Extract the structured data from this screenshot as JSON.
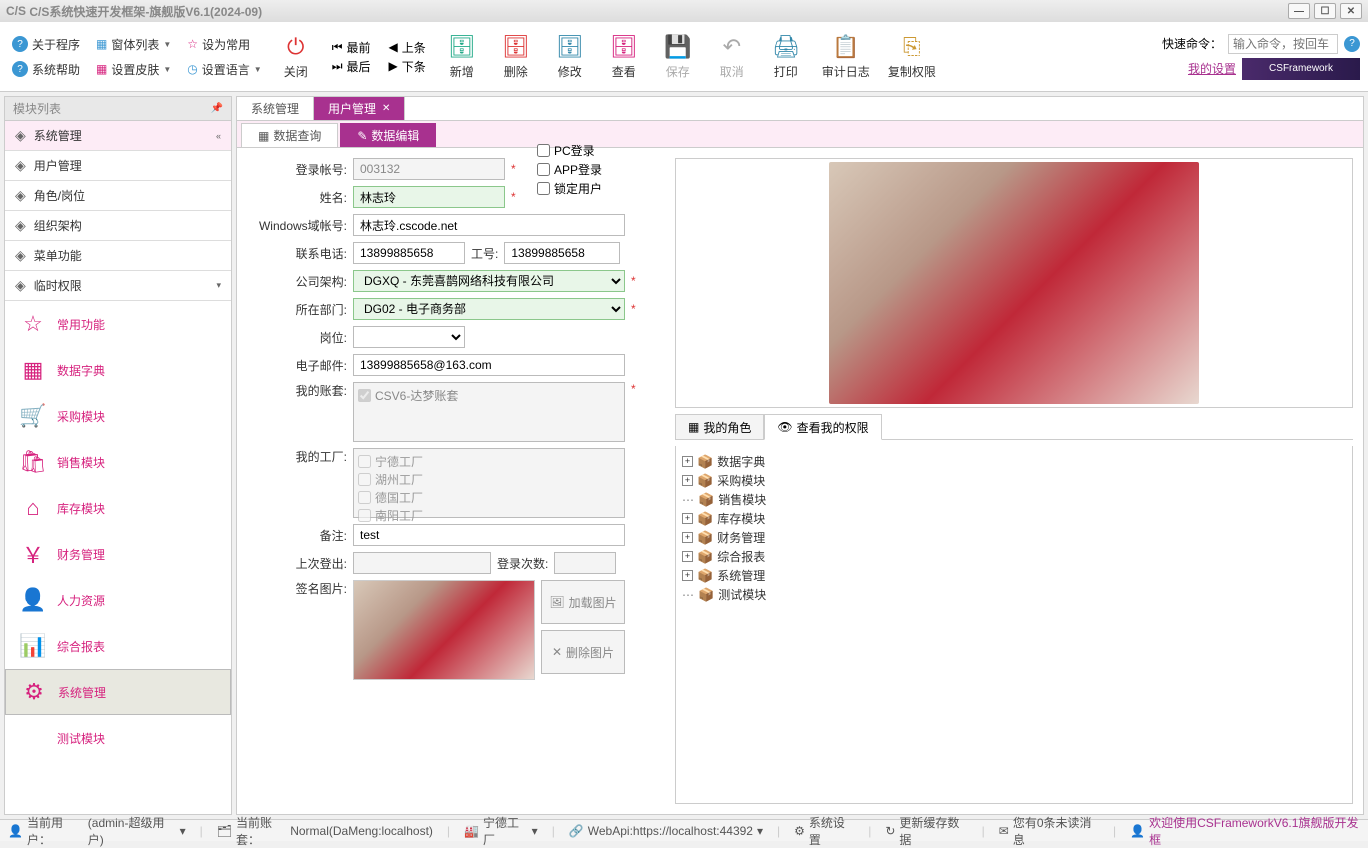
{
  "window_title": "C/S系统快速开发框架-旗舰版V6.1(2024-09)",
  "toolbar_links": {
    "about": "关于程序",
    "windows": "窗体列表",
    "set_common": "设为常用",
    "help": "系统帮助",
    "skin": "设置皮肤",
    "lang": "设置语言"
  },
  "nav": {
    "first": "最前",
    "prev": "上条",
    "last": "最后",
    "next": "下条"
  },
  "toolbar": {
    "close": "关闭",
    "add": "新增",
    "delete": "删除",
    "edit": "修改",
    "view": "查看",
    "save": "保存",
    "cancel": "取消",
    "print": "打印",
    "audit": "审计日志",
    "perm": "复制权限"
  },
  "quick_cmd_label": "快速命令：",
  "quick_cmd_placeholder": "输入命令，按回车",
  "my_settings": "我的设置",
  "logo": "CSFramework",
  "sidebar_header": "模块列表",
  "sidebar_tree": [
    {
      "label": "系统管理",
      "top": true,
      "exp": "«"
    },
    {
      "label": "用户管理"
    },
    {
      "label": "角色/岗位"
    },
    {
      "label": "组织架构"
    },
    {
      "label": "菜单功能"
    },
    {
      "label": "临时权限",
      "exp": "▾"
    }
  ],
  "sidebar_big": [
    {
      "label": "常用功能",
      "icon": "☆"
    },
    {
      "label": "数据字典",
      "icon": "▦"
    },
    {
      "label": "采购模块",
      "icon": "🛒"
    },
    {
      "label": "销售模块",
      "icon": "🛍"
    },
    {
      "label": "库存模块",
      "icon": "⌂"
    },
    {
      "label": "财务管理",
      "icon": "￥"
    },
    {
      "label": "人力资源",
      "icon": "👤"
    },
    {
      "label": "综合报表",
      "icon": "📊"
    },
    {
      "label": "系统管理",
      "icon": "⚙",
      "active": true
    },
    {
      "label": "测试模块",
      "icon": "</>"
    }
  ],
  "tabs": [
    {
      "label": "系统管理"
    },
    {
      "label": "用户管理",
      "active": true,
      "closable": true
    }
  ],
  "subtabs": [
    {
      "label": "数据查询",
      "icon": "▦"
    },
    {
      "label": "数据编辑",
      "icon": "✎",
      "active": true
    }
  ],
  "form": {
    "login_id": {
      "label": "登录帐号:",
      "value": "003132"
    },
    "name": {
      "label": "姓名:",
      "value": "林志玲"
    },
    "domain": {
      "label": "Windows域帐号:",
      "value": "林志玲.cscode.net"
    },
    "phone": {
      "label": "联系电话:",
      "value": "13899885658"
    },
    "empno": {
      "label": "工号:",
      "value": "13899885658"
    },
    "company": {
      "label": "公司架构:",
      "value": "DGXQ - 东莞喜鹊网络科技有限公司"
    },
    "dept": {
      "label": "所在部门:",
      "value": "DG02 - 电子商务部"
    },
    "post": {
      "label": "岗位:"
    },
    "email": {
      "label": "电子邮件:",
      "value": "13899885658@163.com"
    },
    "myacct": {
      "label": "我的账套:",
      "value": "CSV6-达梦账套"
    },
    "myfactory": {
      "label": "我的工厂:"
    },
    "factories": [
      "宁德工厂",
      "湖州工厂",
      "德国工厂",
      "南阳工厂"
    ],
    "remark": {
      "label": "备注:",
      "value": "test"
    },
    "last_logout": {
      "label": "上次登出:"
    },
    "login_count": {
      "label": "登录次数:"
    },
    "sig": {
      "label": "签名图片:"
    },
    "pc_login": "PC登录",
    "app_login": "APP登录",
    "lock_user": "锁定用户",
    "load_img": "加载图片",
    "del_img": "删除图片"
  },
  "rtabs": [
    {
      "label": "我的角色",
      "icon": "▦"
    },
    {
      "label": "查看我的权限",
      "icon": "👁",
      "active": true
    }
  ],
  "tree": [
    {
      "label": "数据字典",
      "plus": true
    },
    {
      "label": "采购模块",
      "plus": true
    },
    {
      "label": "销售模块",
      "plus": false
    },
    {
      "label": "库存模块",
      "plus": true
    },
    {
      "label": "财务管理",
      "plus": true
    },
    {
      "label": "综合报表",
      "plus": true
    },
    {
      "label": "系统管理",
      "plus": true
    },
    {
      "label": "测试模块",
      "plus": false
    }
  ],
  "status": {
    "user_label": "当前用户：",
    "user": "(admin-超级用户)",
    "acct_label": "当前账套：",
    "acct": "Normal(DaMeng:localhost)",
    "factory": "宁德工厂",
    "api": "WebApi:https://localhost:44392",
    "settings": "系统设置",
    "refresh": "更新缓存数据",
    "msg": "您有0条未读消息",
    "welcome": "欢迎使用CSFrameworkV6.1旗舰版开发框"
  }
}
